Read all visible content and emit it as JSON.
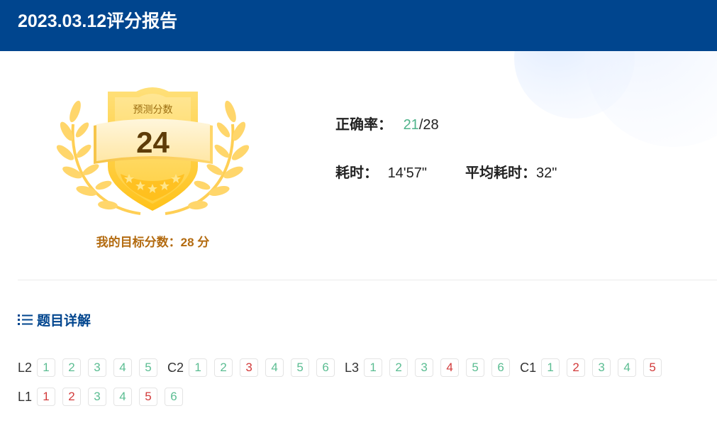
{
  "header": {
    "title": "2023.03.12评分报告"
  },
  "badge": {
    "label": "预测分数",
    "score": "24"
  },
  "target": {
    "text": "我的目标分数：28 分"
  },
  "stats": {
    "accuracy_label": "正确率：",
    "accuracy_correct": "21",
    "accuracy_total": "/28",
    "time_label": "耗时：",
    "time_value": "14'57\"",
    "avg_label": "平均耗时：",
    "avg_value": "32\""
  },
  "section": {
    "title": "题目详解"
  },
  "colors": {
    "header_bg": "#00458e",
    "correct": "#5bbd92",
    "wrong": "#d23a3a",
    "badge_gold": "#ffc107",
    "target_text": "#b36b10"
  },
  "question_groups": [
    {
      "label": "L2",
      "row": 0,
      "items": [
        {
          "n": "1",
          "status": "correct"
        },
        {
          "n": "2",
          "status": "correct"
        },
        {
          "n": "3",
          "status": "correct"
        },
        {
          "n": "4",
          "status": "correct"
        },
        {
          "n": "5",
          "status": "correct"
        }
      ]
    },
    {
      "label": "C2",
      "row": 0,
      "items": [
        {
          "n": "1",
          "status": "correct"
        },
        {
          "n": "2",
          "status": "correct"
        },
        {
          "n": "3",
          "status": "wrong"
        },
        {
          "n": "4",
          "status": "correct"
        },
        {
          "n": "5",
          "status": "correct"
        },
        {
          "n": "6",
          "status": "correct"
        }
      ]
    },
    {
      "label": "L3",
      "row": 0,
      "items": [
        {
          "n": "1",
          "status": "correct"
        },
        {
          "n": "2",
          "status": "correct"
        },
        {
          "n": "3",
          "status": "correct"
        },
        {
          "n": "4",
          "status": "wrong"
        },
        {
          "n": "5",
          "status": "correct"
        },
        {
          "n": "6",
          "status": "correct"
        }
      ]
    },
    {
      "label": "C1",
      "row": 0,
      "items": [
        {
          "n": "1",
          "status": "correct"
        },
        {
          "n": "2",
          "status": "wrong"
        },
        {
          "n": "3",
          "status": "correct"
        },
        {
          "n": "4",
          "status": "correct"
        },
        {
          "n": "5",
          "status": "wrong"
        }
      ]
    },
    {
      "label": "L1",
      "row": 1,
      "items": [
        {
          "n": "1",
          "status": "wrong"
        },
        {
          "n": "2",
          "status": "wrong"
        },
        {
          "n": "3",
          "status": "correct"
        },
        {
          "n": "4",
          "status": "correct"
        },
        {
          "n": "5",
          "status": "wrong"
        },
        {
          "n": "6",
          "status": "correct"
        }
      ]
    }
  ]
}
